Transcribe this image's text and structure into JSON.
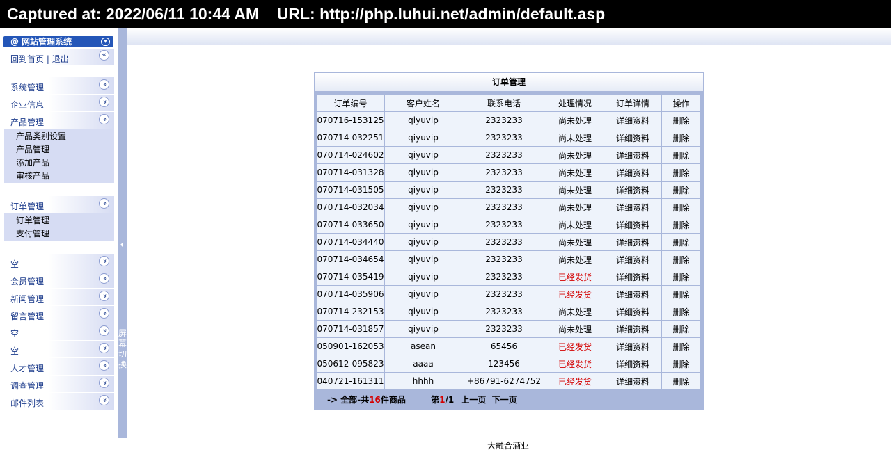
{
  "capture": {
    "text": "Captured at: 2022/06/11 10:44 AM    URL: http://php.luhui.net/admin/default.asp"
  },
  "menu": {
    "title": "网站管理系统",
    "home_link": "回到首页",
    "separator": " | ",
    "logout_link": "退出",
    "sections": [
      {
        "label": "系统管理"
      },
      {
        "label": "企业信息"
      },
      {
        "label": "产品管理",
        "items": [
          "产品类别设置",
          "产品管理",
          "添加产品",
          "审核产品"
        ]
      },
      {
        "label": "订单管理",
        "items": [
          "订单管理",
          "支付管理"
        ]
      },
      {
        "label": "空"
      },
      {
        "label": "会员管理"
      },
      {
        "label": "新闻管理"
      },
      {
        "label": "留言管理"
      },
      {
        "label": "空"
      },
      {
        "label": "空"
      },
      {
        "label": "人才管理"
      },
      {
        "label": "调查管理"
      },
      {
        "label": "邮件列表"
      }
    ]
  },
  "splitter": {
    "label": "屏幕切换"
  },
  "orders": {
    "title": "订单管理",
    "columns": [
      "订单编号",
      "客户姓名",
      "联系电话",
      "处理情况",
      "订单详情",
      "操作"
    ],
    "detail_label": "详细资料",
    "delete_label": "删除",
    "rows": [
      {
        "id": "070716-153125",
        "name": "qiyuvip",
        "phone": "2323233",
        "status": "尚未处理",
        "shipped": false
      },
      {
        "id": "070714-032251",
        "name": "qiyuvip",
        "phone": "2323233",
        "status": "尚未处理",
        "shipped": false
      },
      {
        "id": "070714-024602",
        "name": "qiyuvip",
        "phone": "2323233",
        "status": "尚未处理",
        "shipped": false
      },
      {
        "id": "070714-031328",
        "name": "qiyuvip",
        "phone": "2323233",
        "status": "尚未处理",
        "shipped": false
      },
      {
        "id": "070714-031505",
        "name": "qiyuvip",
        "phone": "2323233",
        "status": "尚未处理",
        "shipped": false
      },
      {
        "id": "070714-032034",
        "name": "qiyuvip",
        "phone": "2323233",
        "status": "尚未处理",
        "shipped": false
      },
      {
        "id": "070714-033650",
        "name": "qiyuvip",
        "phone": "2323233",
        "status": "尚未处理",
        "shipped": false
      },
      {
        "id": "070714-034440",
        "name": "qiyuvip",
        "phone": "2323233",
        "status": "尚未处理",
        "shipped": false
      },
      {
        "id": "070714-034654",
        "name": "qiyuvip",
        "phone": "2323233",
        "status": "尚未处理",
        "shipped": false
      },
      {
        "id": "070714-035419",
        "name": "qiyuvip",
        "phone": "2323233",
        "status": "已经发货",
        "shipped": true
      },
      {
        "id": "070714-035906",
        "name": "qiyuvip",
        "phone": "2323233",
        "status": "已经发货",
        "shipped": true
      },
      {
        "id": "070714-232153",
        "name": "qiyuvip",
        "phone": "2323233",
        "status": "尚未处理",
        "shipped": false
      },
      {
        "id": "070714-031857",
        "name": "qiyuvip",
        "phone": "2323233",
        "status": "尚未处理",
        "shipped": false
      },
      {
        "id": "050901-162053",
        "name": "asean",
        "phone": "65456",
        "status": "已经发货",
        "shipped": true
      },
      {
        "id": "050612-095823",
        "name": "aaaa",
        "phone": "123456",
        "status": "已经发货",
        "shipped": true
      },
      {
        "id": "040721-161311",
        "name": "hhhh",
        "phone": "+86791-6274752",
        "status": "已经发货",
        "shipped": true
      }
    ],
    "footer": {
      "prefix": "-> 全部-共",
      "count": "16",
      "suffix": "件商品",
      "page_prefix": "第",
      "page_current": "1",
      "page_total": "/1",
      "prev": "上一页",
      "next": "下一页"
    }
  },
  "company": "大融合酒业",
  "colors": {
    "accent": "#2456b8",
    "shipped": "#d40000",
    "panel": "#a9b7db"
  }
}
